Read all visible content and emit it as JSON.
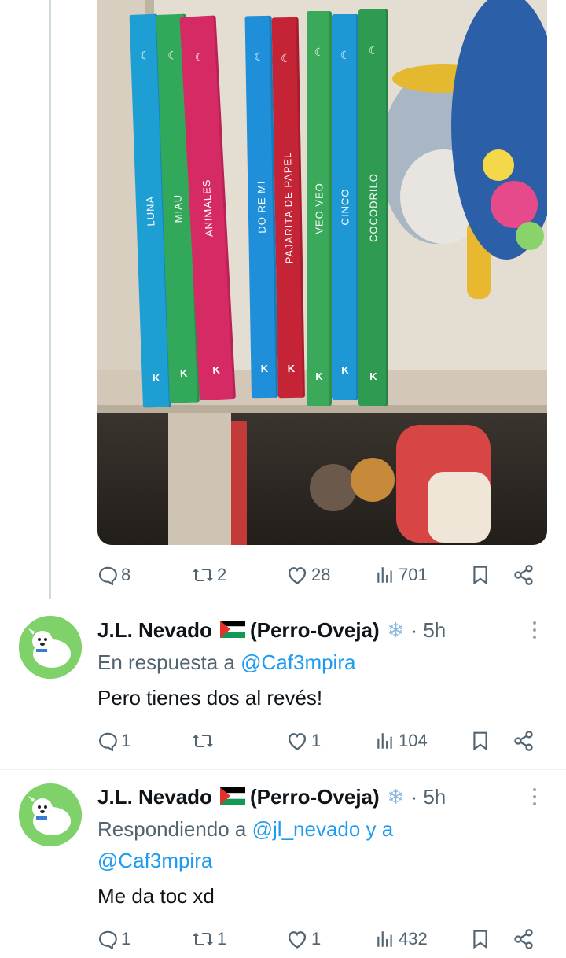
{
  "tweet": {
    "image_alt": "",
    "book_spines": [
      {
        "title": "LUNA",
        "color": "#1e9fd4"
      },
      {
        "title": "MIAU",
        "color": "#32a95a"
      },
      {
        "title": "ANIMALES",
        "color": "#d62a64"
      },
      {
        "title": "DO RE MI",
        "color": "#1e8fd8"
      },
      {
        "title": "PAJARITA DE PAPEL",
        "color": "#c42435"
      },
      {
        "title": "VEO VEO",
        "color": "#3aa95a"
      },
      {
        "title": "CINCO",
        "color": "#1e98d4"
      },
      {
        "title": "COCODRILO",
        "color": "#2e9a52"
      }
    ],
    "actions": {
      "replies": "8",
      "reposts": "2",
      "likes": "28",
      "views": "701"
    }
  },
  "replies": [
    {
      "author": "J.L. Nevado",
      "author_suffix": "(Perro-Oveja)",
      "time": "· 5h",
      "context_prefix": "En respuesta a",
      "context_handle": "@Caf3mpira",
      "context_line2": "",
      "text": "Pero tienes dos al revés!",
      "actions": {
        "replies": "1",
        "reposts": "",
        "likes": "1",
        "views": "104"
      }
    },
    {
      "author": "J.L. Nevado",
      "author_suffix": "(Perro-Oveja)",
      "time": "· 5h",
      "context_prefix": "Respondiendo a",
      "context_handle": "@jl_nevado y a",
      "context_line2": "@Caf3mpira",
      "text": "Me da toc xd",
      "actions": {
        "replies": "1",
        "reposts": "1",
        "likes": "1",
        "views": "432"
      }
    }
  ],
  "icons": {
    "reply": "reply-icon",
    "repost": "repost-icon",
    "like": "heart-icon",
    "views": "views-icon",
    "bookmark": "bookmark-icon",
    "share": "share-icon",
    "verified": "snowflake-icon",
    "flag": "palestine-flag-icon"
  },
  "colors": {
    "accent": "#1d9bf0",
    "muted": "#536471",
    "text": "#0f1419"
  }
}
